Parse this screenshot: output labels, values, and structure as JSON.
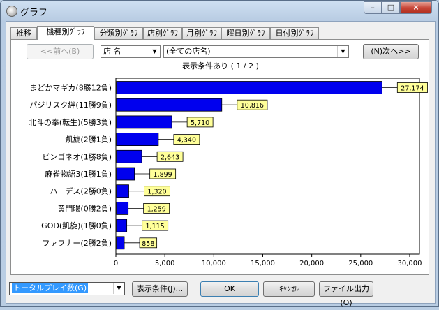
{
  "window": {
    "title": "グラフ",
    "min_glyph": "–",
    "max_glyph": "□",
    "close_glyph": "×"
  },
  "tabs": [
    {
      "label": "推移"
    },
    {
      "label": "機種別ｸﾞﾗﾌ"
    },
    {
      "label": "分類別ｸﾞﾗﾌ"
    },
    {
      "label": "店別ｸﾞﾗﾌ"
    },
    {
      "label": "月別ｸﾞﾗﾌ"
    },
    {
      "label": "曜日別ｸﾞﾗﾌ"
    },
    {
      "label": "日付別ｸﾞﾗﾌ"
    }
  ],
  "active_tab": 1,
  "nav": {
    "prev_label": "<<前へ(B)",
    "next_label": "(N)次へ>>",
    "field_select": "店 名",
    "value_select": "(全ての店名)",
    "status_prefix": "表示条件あり (",
    "page": "1",
    "page_sep": "/",
    "total": "2",
    "status_suffix": ")"
  },
  "chart_data": {
    "type": "bar",
    "orientation": "horizontal",
    "categories": [
      "まどかマギカ(8勝12負)",
      "バジリスク絆(11勝9負)",
      "北斗の拳(転生)(5勝3負)",
      "凱旋(2勝1負)",
      "ビンゴネオ(1勝8負)",
      "麻雀物語3(1勝1負)",
      "ハーデス(2勝0負)",
      "黄門暍(0勝2負)",
      "GOD(凱旋)(1勝0負)",
      "ファフナー(2勝2負)"
    ],
    "values": [
      27174,
      10816,
      5710,
      4340,
      2643,
      1899,
      1320,
      1259,
      1115,
      858
    ],
    "value_labels": [
      "27,174",
      "10,816",
      "5,710",
      "4,340",
      "2,643",
      "1,899",
      "1,320",
      "1,259",
      "1,115",
      "858"
    ],
    "xlim": [
      0,
      31000
    ],
    "ticks": [
      0,
      5000,
      10000,
      15000,
      20000,
      25000,
      30000
    ],
    "tick_labels": [
      "0",
      "5,000",
      "10,000",
      "15,000",
      "20,000",
      "25,000",
      "30,000"
    ],
    "bar_color": "#0000ee",
    "label_bg": "#ffff99",
    "grid": false,
    "title": "",
    "xlabel": "",
    "ylabel": ""
  },
  "bottom": {
    "metric_select": "トータルプレイ数(G)",
    "condition_button": "表示条件(J)...",
    "ok_button": "OK",
    "cancel_button": "ｷｬﾝｾﾙ",
    "export_button": "ファイル出力(O)"
  }
}
